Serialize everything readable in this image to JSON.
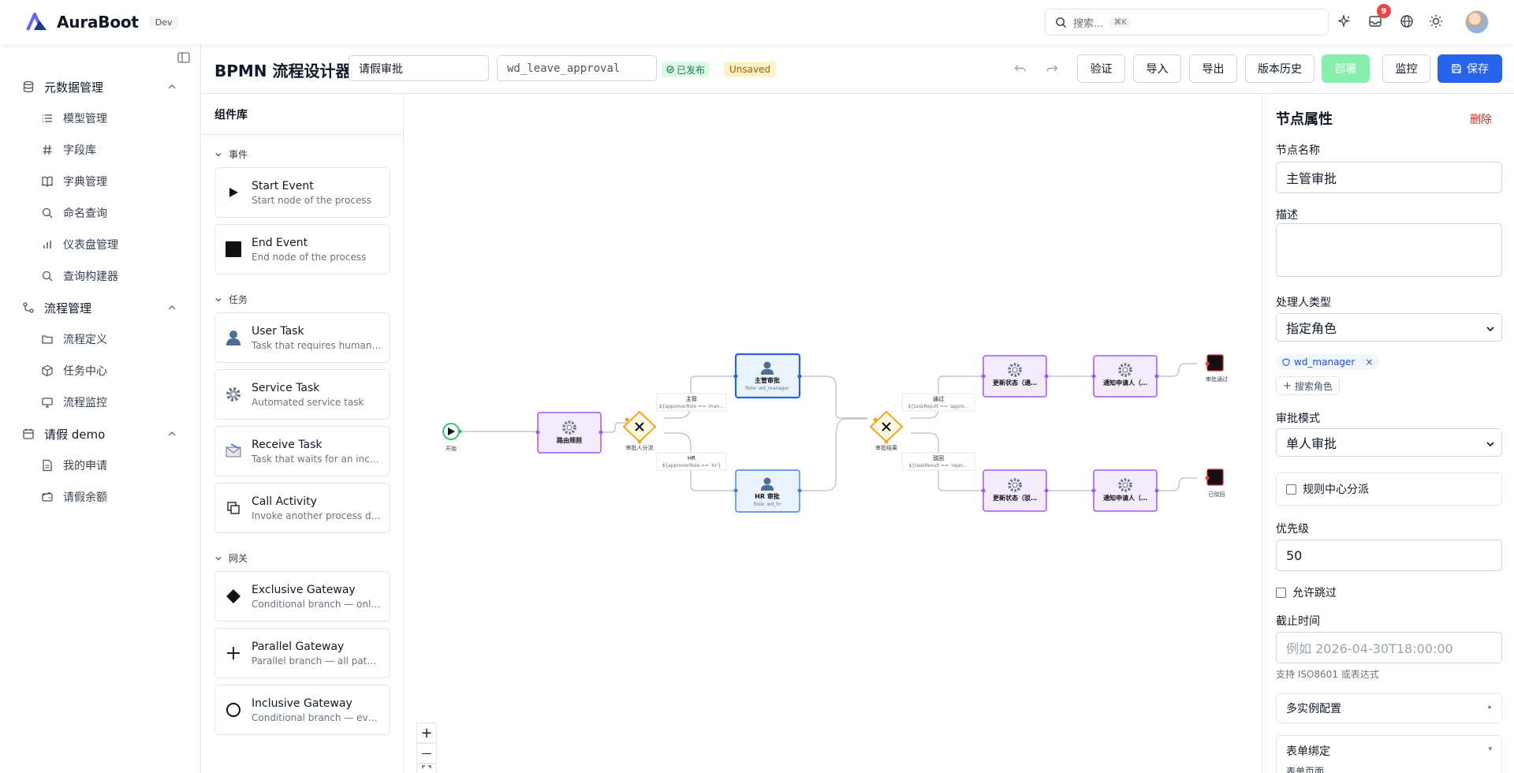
{
  "brand": {
    "name": "AuraBoot",
    "env": "Dev"
  },
  "search": {
    "placeholder": "搜索...",
    "shortcut": "⌘K"
  },
  "notifications": {
    "count": "9"
  },
  "sidebar": {
    "groups": [
      {
        "label": "元数据管理",
        "items": [
          "模型管理",
          "字段库",
          "字典管理",
          "命名查询",
          "仪表盘管理",
          "查询构建器"
        ]
      },
      {
        "label": "流程管理",
        "items": [
          "流程定义",
          "任务中心",
          "流程监控"
        ]
      },
      {
        "label": "请假 demo",
        "items": [
          "我的申请",
          "请假余额"
        ]
      }
    ]
  },
  "designer": {
    "title": "BPMN 流程设计器",
    "process_name": "请假审批",
    "process_key": "wd_leave_approval",
    "status": "已发布",
    "save_state": "Unsaved",
    "buttons": {
      "validate": "验证",
      "import": "导入",
      "export": "导出",
      "history": "版本历史",
      "deploy": "部署",
      "monitor": "监控",
      "save": "保存"
    }
  },
  "palette": {
    "title": "组件库",
    "sections": [
      {
        "label": "事件",
        "items": [
          {
            "name": "Start Event",
            "desc": "Start node of the process",
            "icon": "play-icon"
          },
          {
            "name": "End Event",
            "desc": "End node of the process",
            "icon": "stop-icon"
          }
        ]
      },
      {
        "label": "任务",
        "items": [
          {
            "name": "User Task",
            "desc": "Task that requires human interaction",
            "icon": "user-icon"
          },
          {
            "name": "Service Task",
            "desc": "Automated service task",
            "icon": "gear-icon"
          },
          {
            "name": "Receive Task",
            "desc": "Task that waits for an incoming message",
            "icon": "mail-icon"
          },
          {
            "name": "Call Activity",
            "desc": "Invoke another process definition",
            "icon": "call-activity-icon"
          }
        ]
      },
      {
        "label": "网关",
        "items": [
          {
            "name": "Exclusive Gateway",
            "desc": "Conditional branch — only one path",
            "icon": "diamond-icon"
          },
          {
            "name": "Parallel Gateway",
            "desc": "Parallel branch — all paths execute",
            "icon": "plus-icon"
          },
          {
            "name": "Inclusive Gateway",
            "desc": "Conditional branch — every matching path",
            "icon": "circle-icon"
          }
        ]
      }
    ]
  },
  "diagram": {
    "start_label": "开始",
    "route_rule": "路由规则",
    "gateway1_label": "审批人分流",
    "cond_manager_title": "主管",
    "cond_manager_expr": "${approverRole == 'man…",
    "cond_hr_title": "HR",
    "cond_hr_expr": "${approverRole == 'hr'}",
    "manager_task": "主管审批",
    "manager_role": "Role: wd_manager",
    "hr_task": "HR 审批",
    "hr_role": "Role: wd_hr",
    "gateway2_label": "审批结果",
    "cond_pass_title": "通过",
    "cond_pass_expr": "${taskResult == 'appro…",
    "cond_reject_title": "驳回",
    "cond_reject_expr": "${taskResult == 'rejec…",
    "update_pass": "更新状态（通…",
    "notify_pass": "通知申请人（…",
    "update_reject": "更新状态（驳…",
    "notify_reject": "通知申请人（…",
    "end_pass": "审批通过",
    "end_reject": "已驳回",
    "zoom_in": "+",
    "zoom_out": "—"
  },
  "properties": {
    "title": "节点属性",
    "delete": "删除",
    "name_label": "节点名称",
    "name_value": "主管审批",
    "desc_label": "描述",
    "assignee_type_label": "处理人类型",
    "assignee_type_value": "指定角色",
    "role_chip": "wd_manager",
    "role_search": "搜索角色",
    "approval_mode_label": "审批模式",
    "approval_mode_value": "单人审批",
    "rule_center_label": "规则中心分派",
    "priority_label": "优先级",
    "priority_value": "50",
    "allow_skip_label": "允许跳过",
    "deadline_label": "截止时间",
    "deadline_placeholder": "例如 2026-04-30T18:00:00",
    "deadline_help": "支持 ISO8601 或表达式",
    "multi_instance": "多实例配置",
    "form_binding": "表单绑定",
    "form_page": "表单页面"
  },
  "colors": {
    "primary": "#2563eb",
    "task_purple": "#a855f7",
    "gateway_orange": "#f59e0b",
    "danger": "#dc2626",
    "success": "#15803d"
  }
}
